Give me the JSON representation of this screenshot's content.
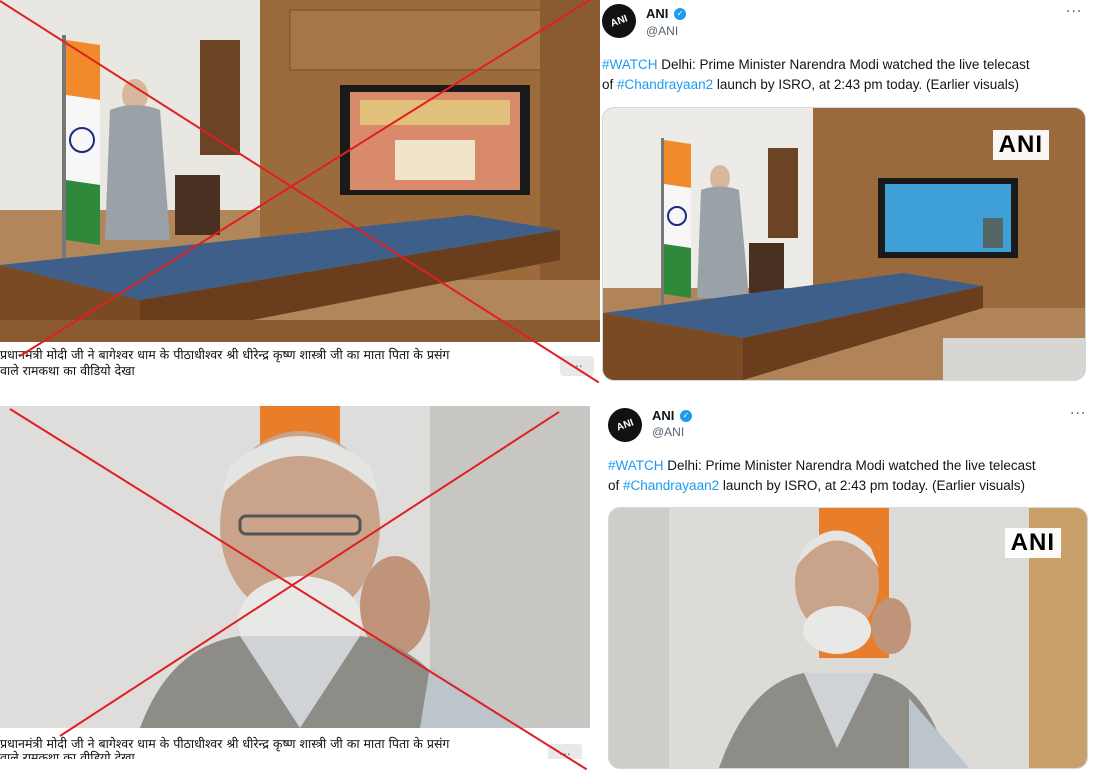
{
  "left_panels": [
    {
      "caption_line1": "प्रधानमंत्री मोदी जी ने बागेश्वर धाम के पीठाधीश्वर श्री धीरेन्द्र कृष्ण शास्त्री जी का माता पिता के प्रसंग",
      "caption_line2": "वाले रामकथा का वीडियो देखा",
      "more": "..."
    },
    {
      "caption_line1": "प्रधानमंत्री मोदी जी ने बागेश्वर धाम के पीठाधीश्वर श्री धीरेन्द्र कृष्ण शास्त्री जी का माता पिता के प्रसंग",
      "caption_line2": "वाले रामकथा का वीडियो देखा",
      "more": "..."
    }
  ],
  "tweets": [
    {
      "avatar_text": "ANI",
      "name": "ANI",
      "handle": "@ANI",
      "more": "···",
      "hashtag1": "#WATCH",
      "text1": " Delhi: Prime Minister Narendra Modi watched the live telecast",
      "text2_prefix": "of ",
      "hashtag2": "#Chandrayaan2",
      "text2_suffix": " launch by ISRO, at 2:43 pm today. (Earlier visuals)",
      "watermark": "ANI"
    },
    {
      "avatar_text": "ANI",
      "name": "ANI",
      "handle": "@ANI",
      "more": "···",
      "hashtag1": "#WATCH",
      "text1": " Delhi: Prime Minister Narendra Modi watched the live telecast",
      "text2_prefix": "of ",
      "hashtag2": "#Chandrayaan2",
      "text2_suffix": " launch by ISRO, at 2:43 pm today. (Earlier visuals)",
      "watermark": "ANI"
    }
  ],
  "colors": {
    "cross": "#e02020",
    "link": "#1d9bf0",
    "verified": "#1d9bf0"
  }
}
